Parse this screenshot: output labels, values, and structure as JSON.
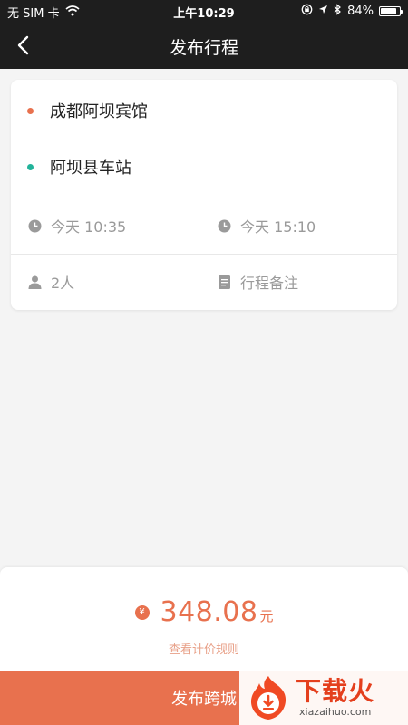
{
  "status_bar": {
    "carrier": "无 SIM 卡",
    "time": "上午10:29",
    "battery": "84%",
    "battery_level": 0.84,
    "icons": [
      "wifi-icon",
      "orientation-lock-icon",
      "location-arrow-icon",
      "bluetooth-icon",
      "battery-icon"
    ]
  },
  "nav": {
    "title": "发布行程",
    "back_icon": "chevron-left-icon"
  },
  "trip": {
    "origin": "成都阿坝宾馆",
    "destination": "阿坝县车站",
    "depart_time": "今天 10:35",
    "arrive_time": "今天 15:10",
    "passengers": "2人",
    "notes_placeholder": "行程备注"
  },
  "fare": {
    "currency_symbol": "¥",
    "amount": "348.08",
    "unit": "元",
    "rules_link": "查看计价规则"
  },
  "publish_button": "发布跨城",
  "watermark": {
    "text": "下载火",
    "url_text": "xiazaihuo.com"
  },
  "colors": {
    "accent": "#e8714e",
    "origin_dot": "#e8714e",
    "destination_dot": "#22b39a",
    "header_bg": "#1e1e1e",
    "page_bg": "#f4f4f4"
  }
}
